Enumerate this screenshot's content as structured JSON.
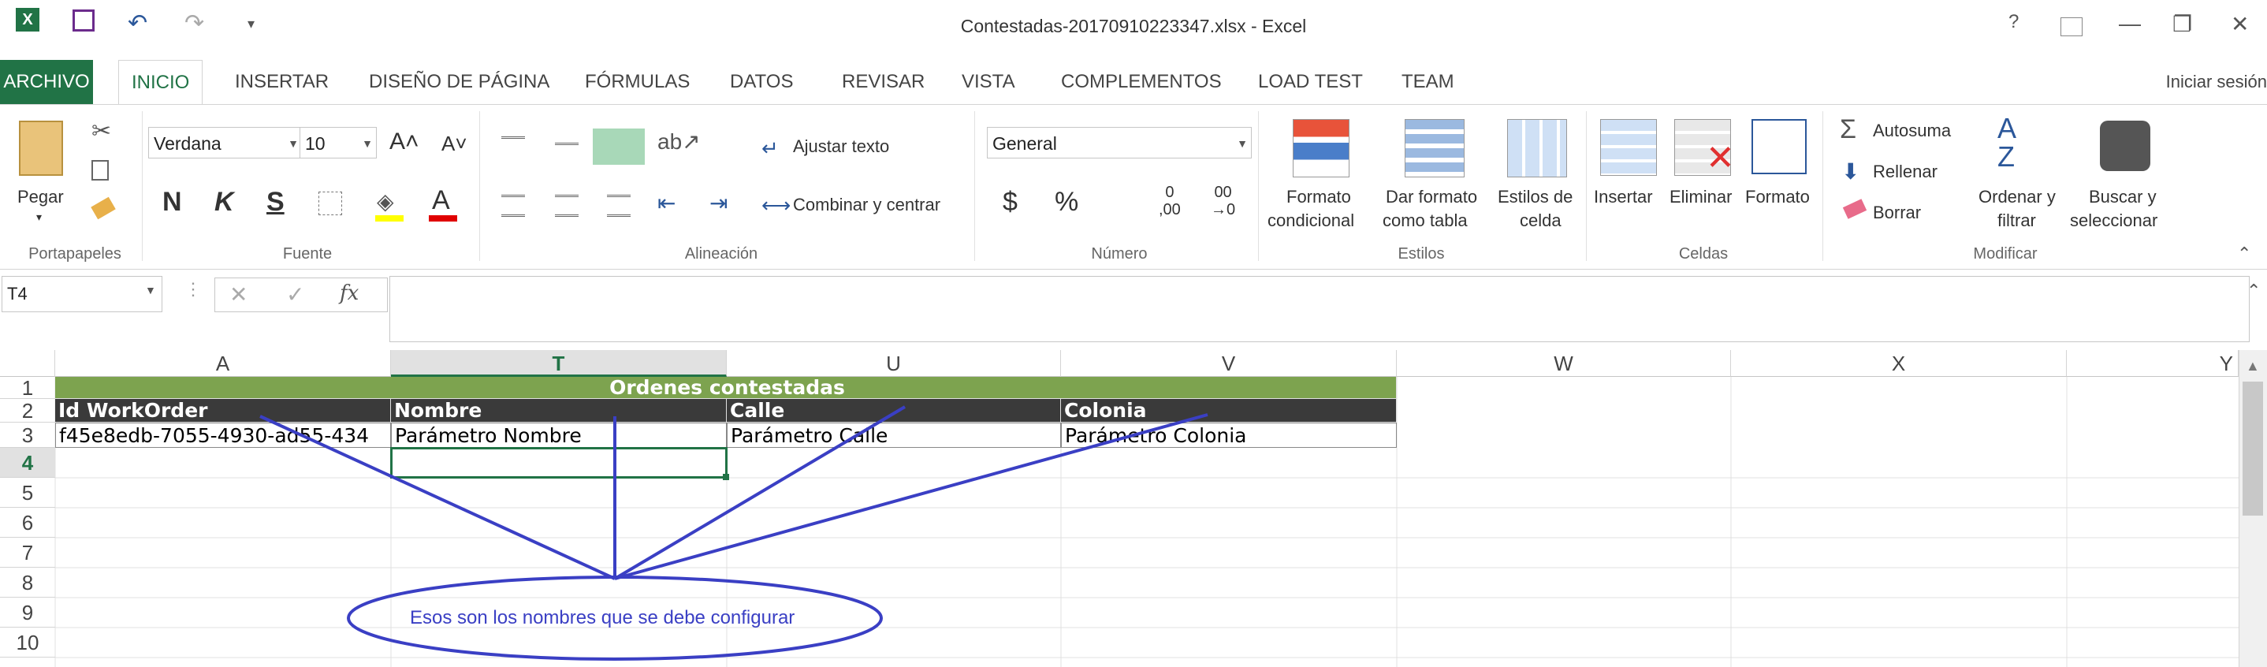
{
  "window": {
    "title": "Contestadas-20170910223347.xlsx - Excel",
    "sign_in": "Iniciar sesión",
    "buttons": {
      "help": "?",
      "minimize": "—",
      "restore": "❐",
      "close": "✕"
    }
  },
  "tabs": [
    {
      "label": "ARCHIVO"
    },
    {
      "label": "INICIO"
    },
    {
      "label": "INSERTAR"
    },
    {
      "label": "DISEÑO DE PÁGINA"
    },
    {
      "label": "FÓRMULAS"
    },
    {
      "label": "DATOS"
    },
    {
      "label": "REVISAR"
    },
    {
      "label": "VISTA"
    },
    {
      "label": "COMPLEMENTOS"
    },
    {
      "label": "LOAD TEST"
    },
    {
      "label": "TEAM"
    }
  ],
  "ribbon": {
    "clipboard": {
      "paste": "Pegar",
      "group": "Portapapeles"
    },
    "font": {
      "family": "Verdana",
      "size": "10",
      "bold": "N",
      "italic": "K",
      "underline": "S",
      "group": "Fuente"
    },
    "alignment": {
      "wrap": "Ajustar texto",
      "merge": "Combinar y centrar",
      "group": "Alineación"
    },
    "number": {
      "format": "General",
      "currency": "$",
      "percent": "%",
      "inc_dec_a": "0",
      "inc_dec_b": ",00",
      "dec_dec_a": "00",
      "dec_dec_b": "→0",
      "group": "Número"
    },
    "styles": {
      "cond1": "Formato",
      "cond2": "condicional",
      "table1": "Dar formato",
      "table2": "como tabla",
      "cell1": "Estilos de",
      "cell2": "celda",
      "group": "Estilos"
    },
    "cells": {
      "insert": "Insertar",
      "delete": "Eliminar",
      "format": "Formato",
      "group": "Celdas"
    },
    "editing": {
      "autosum": "Autosuma",
      "fill": "Rellenar",
      "clear": "Borrar",
      "sort1": "Ordenar y",
      "sort2": "filtrar",
      "find1": "Buscar y",
      "find2": "seleccionar",
      "group": "Modificar"
    }
  },
  "formula_bar": {
    "name_box": "T4",
    "fx": "fx",
    "content": ""
  },
  "columns": [
    "A",
    "T",
    "U",
    "V",
    "W",
    "X",
    "Y"
  ],
  "rows": [
    "1",
    "2",
    "3",
    "4",
    "5",
    "6",
    "7",
    "8",
    "9",
    "10"
  ],
  "sheet": {
    "banner": "Ordenes contestadas",
    "headers": [
      "Id WorkOrder",
      "Nombre",
      "Calle",
      "Colonia"
    ],
    "row3": [
      "f45e8edb-7055-4930-ad55-434",
      "Parámetro Nombre",
      "Parámetro Calle",
      "Parámetro Colonia"
    ]
  },
  "annotation": {
    "text": "Esos son los nombres que se debe configurar",
    "color": "#3a3fc4"
  }
}
